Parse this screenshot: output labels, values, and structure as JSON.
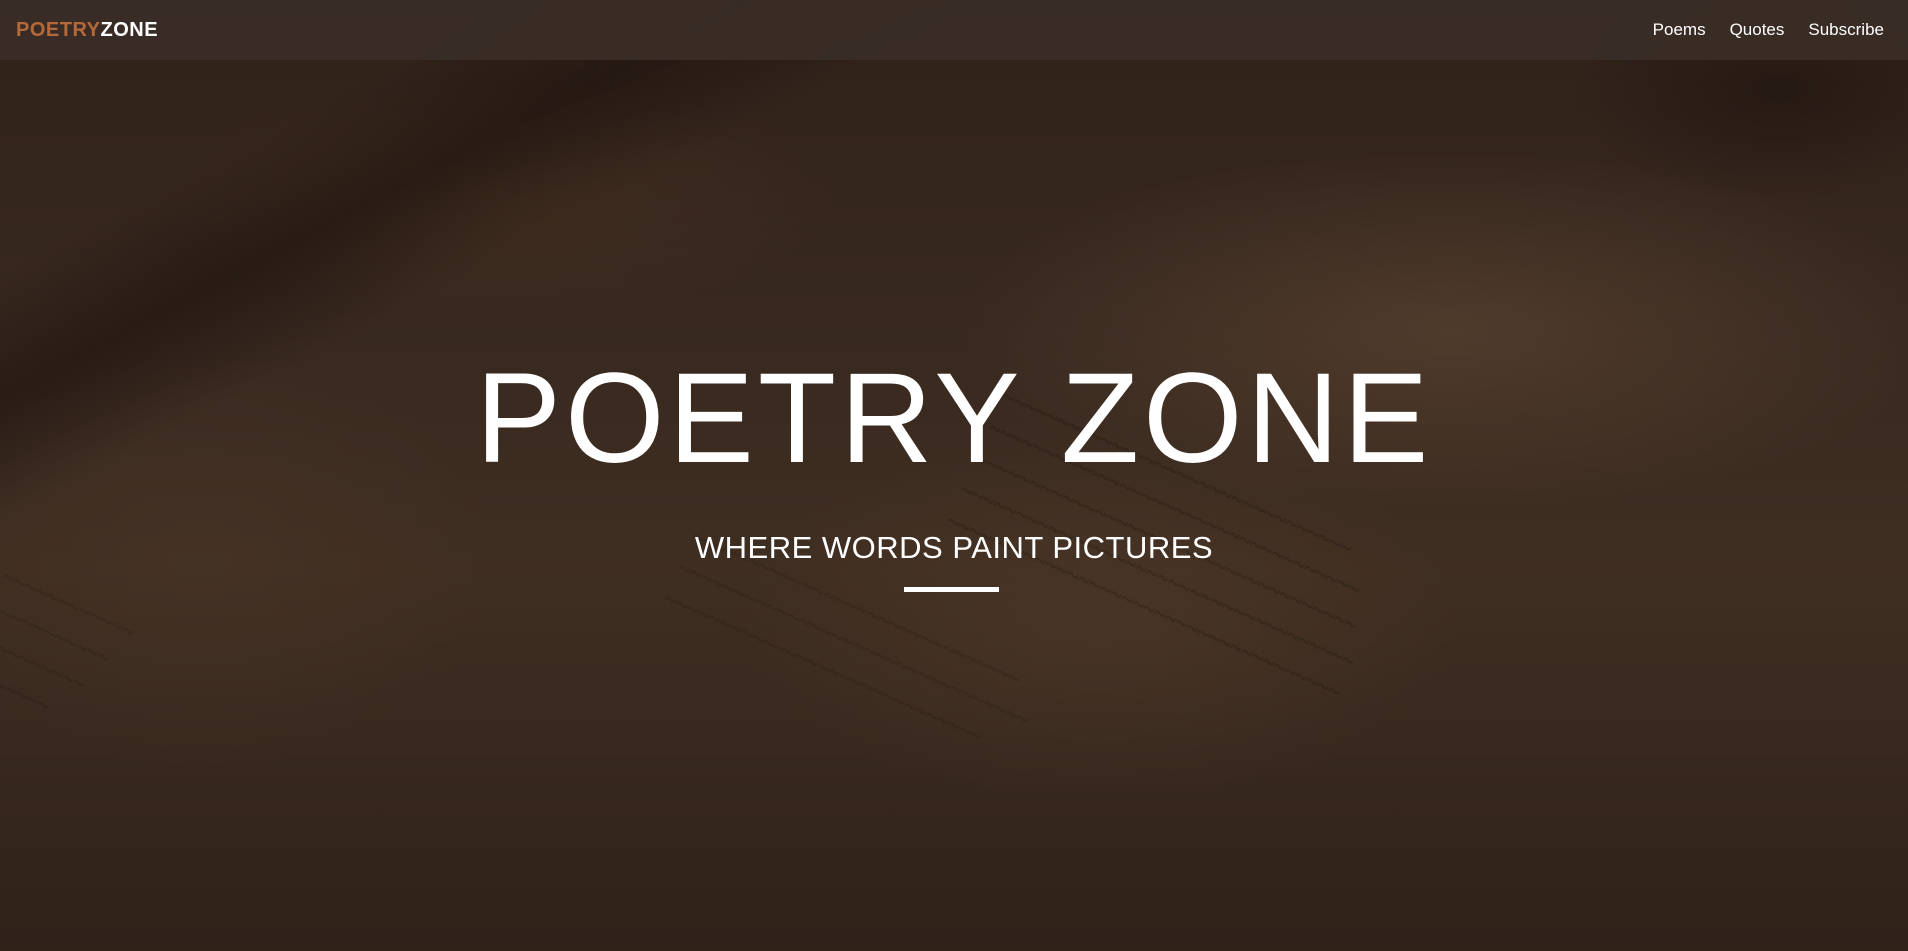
{
  "navbar": {
    "brand_part1": "POETRY",
    "brand_part2": "ZONE",
    "links": [
      {
        "label": "Poems"
      },
      {
        "label": "Quotes"
      },
      {
        "label": "Subscribe"
      }
    ]
  },
  "hero": {
    "title": "POETRY ZONE",
    "subtitle": "WHERE WORDS PAINT PICTURES"
  },
  "colors": {
    "brand_accent": "#b5693a",
    "navbar_bg": "#3a2e27",
    "text": "#ffffff"
  }
}
